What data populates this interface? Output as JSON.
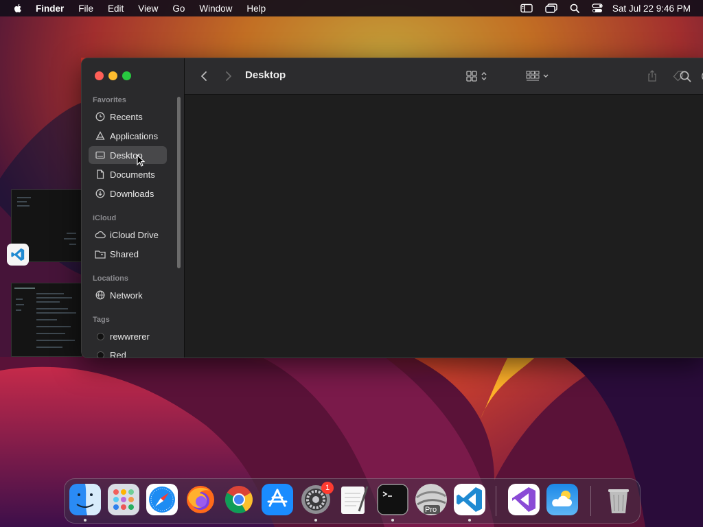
{
  "menubar": {
    "app_name": "Finder",
    "menus": [
      "File",
      "Edit",
      "View",
      "Go",
      "Window",
      "Help"
    ],
    "clock": "Sat Jul 22  9:46 PM",
    "status_icons": [
      "sidebar-toggle-icon",
      "window-switch-icon",
      "spotlight-search-icon",
      "control-center-icon"
    ]
  },
  "finder": {
    "title": "Desktop",
    "sidebar": {
      "favorites_label": "Favorites",
      "favorites": [
        {
          "label": "Recents",
          "icon": "clock-icon"
        },
        {
          "label": "Applications",
          "icon": "applications-icon"
        },
        {
          "label": "Desktop",
          "icon": "desktop-icon",
          "selected": true
        },
        {
          "label": "Documents",
          "icon": "document-icon"
        },
        {
          "label": "Downloads",
          "icon": "downloads-icon"
        }
      ],
      "icloud_label": "iCloud",
      "icloud": [
        {
          "label": "iCloud Drive",
          "icon": "cloud-icon"
        },
        {
          "label": "Shared",
          "icon": "shared-folder-icon"
        }
      ],
      "locations_label": "Locations",
      "locations": [
        {
          "label": "Network",
          "icon": "globe-icon"
        }
      ],
      "tags_label": "Tags",
      "tags": [
        {
          "label": "rewwrerer"
        },
        {
          "label": "Red"
        }
      ]
    },
    "toolbar_icons": [
      "back-icon",
      "forward-icon",
      "icon-view-icon",
      "group-icon",
      "share-icon",
      "tag-icon",
      "more-actions-icon",
      "search-icon"
    ]
  },
  "dock": {
    "badge_count": "1",
    "system_settings_subtitle": "Pro",
    "apps": [
      "Finder",
      "Launchpad",
      "Safari",
      "Firefox",
      "Chrome",
      "App Store",
      "System Settings",
      "TextEdit",
      "Terminal",
      "Pro",
      "Visual Studio Code",
      "Visual Studio",
      "Weather",
      "Trash"
    ]
  },
  "colors": {
    "window_bg": "#1e1e1e",
    "sidebar_bg": "#2a2a2c",
    "selected_bg": "#48484a",
    "close": "#ff5f57",
    "minimize": "#febc2e",
    "maximize": "#28c840"
  }
}
